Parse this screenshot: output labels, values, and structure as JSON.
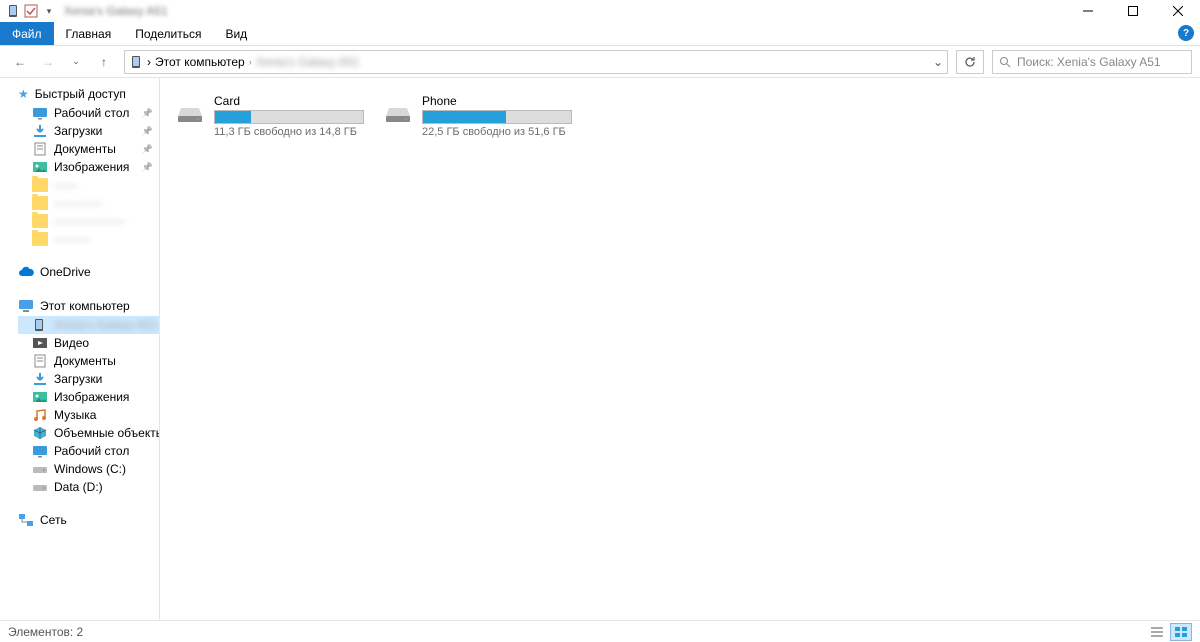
{
  "title": "Xenia's Galaxy A51",
  "ribbon": {
    "file": "Файл",
    "home": "Главная",
    "share": "Поделиться",
    "view": "Вид"
  },
  "breadcrumb": {
    "root": "Этот компьютер",
    "current": "Xenia's Galaxy A51"
  },
  "search": {
    "placeholder": "Поиск: Xenia's Galaxy A51"
  },
  "sidebar": {
    "quick": {
      "header": "Быстрый доступ",
      "items": [
        {
          "label": "Рабочий стол",
          "icon": "desktop"
        },
        {
          "label": "Загрузки",
          "icon": "downloads"
        },
        {
          "label": "Документы",
          "icon": "documents"
        },
        {
          "label": "Изображения",
          "icon": "pictures"
        },
        {
          "label": "——",
          "icon": "folder",
          "blurred": true
        },
        {
          "label": "————",
          "icon": "folder",
          "blurred": true
        },
        {
          "label": "——————",
          "icon": "folder",
          "blurred": true
        },
        {
          "label": "———",
          "icon": "folder",
          "blurred": true
        }
      ]
    },
    "onedrive": "OneDrive",
    "thispc": {
      "header": "Этот компьютер",
      "items": [
        {
          "label": "Xenia's Galaxy A51",
          "icon": "phone",
          "selected": true,
          "blurred": true
        },
        {
          "label": "Видео",
          "icon": "video"
        },
        {
          "label": "Документы",
          "icon": "documents"
        },
        {
          "label": "Загрузки",
          "icon": "downloads"
        },
        {
          "label": "Изображения",
          "icon": "pictures"
        },
        {
          "label": "Музыка",
          "icon": "music"
        },
        {
          "label": "Объемные объекты",
          "icon": "objects3d"
        },
        {
          "label": "Рабочий стол",
          "icon": "desktop"
        },
        {
          "label": "Windows (C:)",
          "icon": "drive"
        },
        {
          "label": "Data (D:)",
          "icon": "drive"
        }
      ]
    },
    "network": "Сеть"
  },
  "drives": [
    {
      "name": "Card",
      "free": "11,3 ГБ свободно из 14,8 ГБ",
      "pct": 24
    },
    {
      "name": "Phone",
      "free": "22,5 ГБ свободно из 51,6 ГБ",
      "pct": 56
    }
  ],
  "status": {
    "count": "Элементов: 2"
  }
}
